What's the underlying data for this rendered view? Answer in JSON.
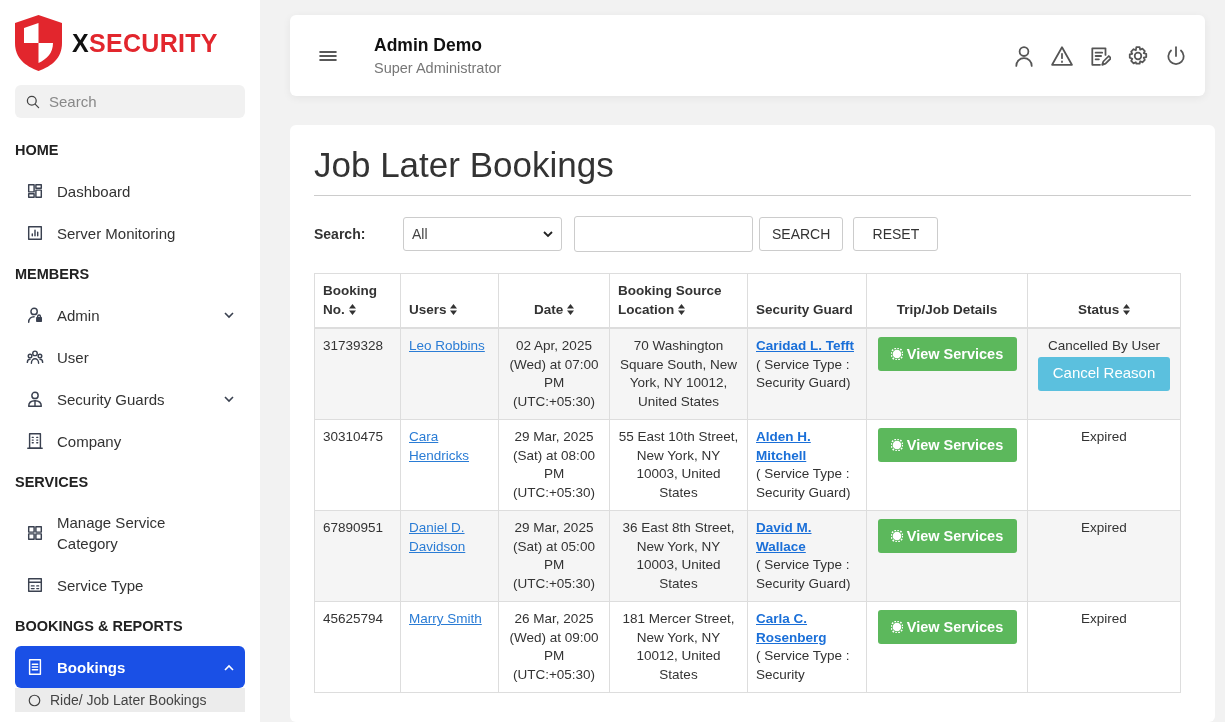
{
  "sidebar": {
    "logo": {
      "accent": "X",
      "text": "SECURITY"
    },
    "search": {
      "placeholder": "Search"
    },
    "sections": [
      {
        "title": "HOME",
        "items": [
          {
            "label": "Dashboard",
            "selected": false
          },
          {
            "label": "Server Monitoring",
            "selected": false
          }
        ]
      },
      {
        "title": "MEMBERS",
        "items": [
          {
            "label": "Admin",
            "selected": false,
            "expanded": false
          },
          {
            "label": "User",
            "selected": false
          },
          {
            "label": "Security Guards",
            "selected": false,
            "expanded": false
          },
          {
            "label": "Company",
            "selected": false
          }
        ]
      },
      {
        "title": "SERVICES",
        "items": [
          {
            "label": "Manage Service Category",
            "selected": false
          },
          {
            "label": "Service Type",
            "selected": false
          }
        ]
      },
      {
        "title": "BOOKINGS & REPORTS",
        "items": [
          {
            "label": "Bookings",
            "selected": true,
            "expanded": true,
            "children": [
              {
                "label": "Ride/ Job Later Bookings",
                "selected": false
              }
            ]
          }
        ]
      }
    ]
  },
  "header": {
    "name": "Admin Demo",
    "role": "Super Administrator"
  },
  "page": {
    "title": "Job Later Bookings",
    "search_label": "Search:",
    "filter": {
      "value": "All"
    },
    "buttons": [
      "SEARCH",
      "RESET"
    ]
  },
  "table": {
    "columns": [
      {
        "label": "Booking No.",
        "sortable": true
      },
      {
        "label": "Users",
        "sortable": true
      },
      {
        "label": "Date",
        "sortable": true
      },
      {
        "label": "Booking Source Location",
        "sortable": true
      },
      {
        "label": "Security Guard",
        "sortable": false
      },
      {
        "label": "Trip/Job Details",
        "sortable": false
      },
      {
        "label": "Status",
        "sortable": true
      }
    ],
    "rows": [
      {
        "booking_no": "31739328",
        "user": "Leo Robbins",
        "date": "02 Apr, 2025 (Wed) at 07:00 PM (UTC:+05:30)",
        "location": "70 Washington Square South, New York, NY 10012, United States",
        "guard": "Caridad L. Tefft",
        "service_type": "( Service Type : Security Guard)",
        "action": "View Services",
        "status": "Cancelled By User",
        "status_button": "Cancel Reason"
      },
      {
        "booking_no": "30310475",
        "user": "Cara Hendricks",
        "date": "29 Mar, 2025 (Sat) at 08:00 PM (UTC:+05:30)",
        "location": "55 East 10th Street, New York, NY 10003, United States",
        "guard": "Alden H. Mitchell",
        "service_type": "( Service Type : Security Guard)",
        "action": "View Services",
        "status": "Expired"
      },
      {
        "booking_no": "67890951",
        "user": "Daniel D. Davidson",
        "date": "29 Mar, 2025 (Sat) at 05:00 PM (UTC:+05:30)",
        "location": "36 East 8th Street, New York, NY 10003, United States",
        "guard": "David M. Wallace",
        "service_type": "( Service Type : Security Guard)",
        "action": "View Services",
        "status": "Expired"
      },
      {
        "booking_no": "45625794",
        "user": "Marry Smith",
        "date": "26 Mar, 2025 (Wed) at 09:00 PM (UTC:+05:30)",
        "location": "181 Mercer Street, New York, NY 10012, United States",
        "guard": "Carla C. Rosenberg",
        "service_type": "( Service Type : Security",
        "action": "View Services",
        "status": "Expired"
      }
    ]
  }
}
